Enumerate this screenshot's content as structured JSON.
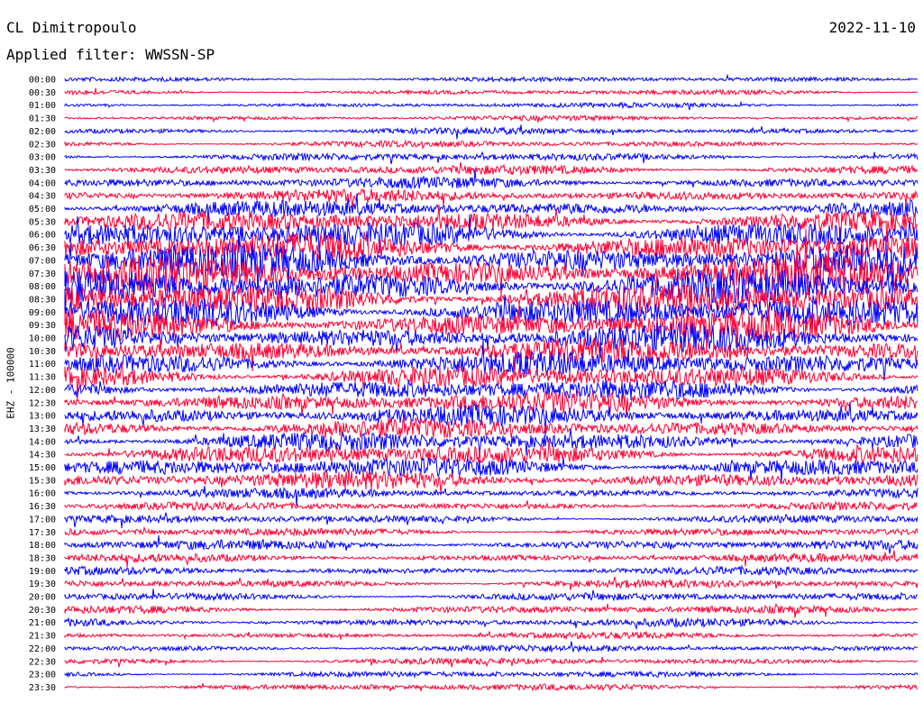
{
  "header": {
    "station": "CL Dimitropoulo",
    "date": "2022-11-10",
    "filter_label": "Applied filter: WWSSN-SP"
  },
  "chart_data": {
    "type": "line",
    "title": "CL Dimitropoulo",
    "ylabel": "EHZ - 100000",
    "row_labels": [
      "00:00",
      "00:30",
      "01:00",
      "01:30",
      "02:00",
      "02:30",
      "03:00",
      "03:30",
      "04:00",
      "04:30",
      "05:00",
      "05:30",
      "06:00",
      "06:30",
      "07:00",
      "07:30",
      "08:00",
      "08:30",
      "09:00",
      "09:30",
      "10:00",
      "10:30",
      "11:00",
      "11:30",
      "12:00",
      "12:30",
      "13:00",
      "13:30",
      "14:00",
      "14:30",
      "15:00",
      "15:30",
      "16:00",
      "16:30",
      "17:00",
      "17:30",
      "18:00",
      "18:30",
      "19:00",
      "19:30",
      "20:00",
      "20:30",
      "21:00",
      "21:30",
      "22:00",
      "22:30",
      "23:00",
      "23:30"
    ],
    "row_amplitude": [
      3,
      3,
      3,
      3,
      4,
      4,
      5,
      6,
      7,
      8,
      10,
      13,
      16,
      18,
      20,
      21,
      21,
      20,
      19,
      18,
      17,
      16,
      15,
      14,
      13,
      13,
      12,
      12,
      12,
      12,
      12,
      11,
      6,
      5,
      5,
      5,
      6,
      5,
      5,
      5,
      5,
      5,
      5,
      4,
      4,
      4,
      4,
      4
    ],
    "colors": [
      "#0000ff",
      "#ff0033"
    ],
    "grid": false,
    "legend": "none"
  }
}
